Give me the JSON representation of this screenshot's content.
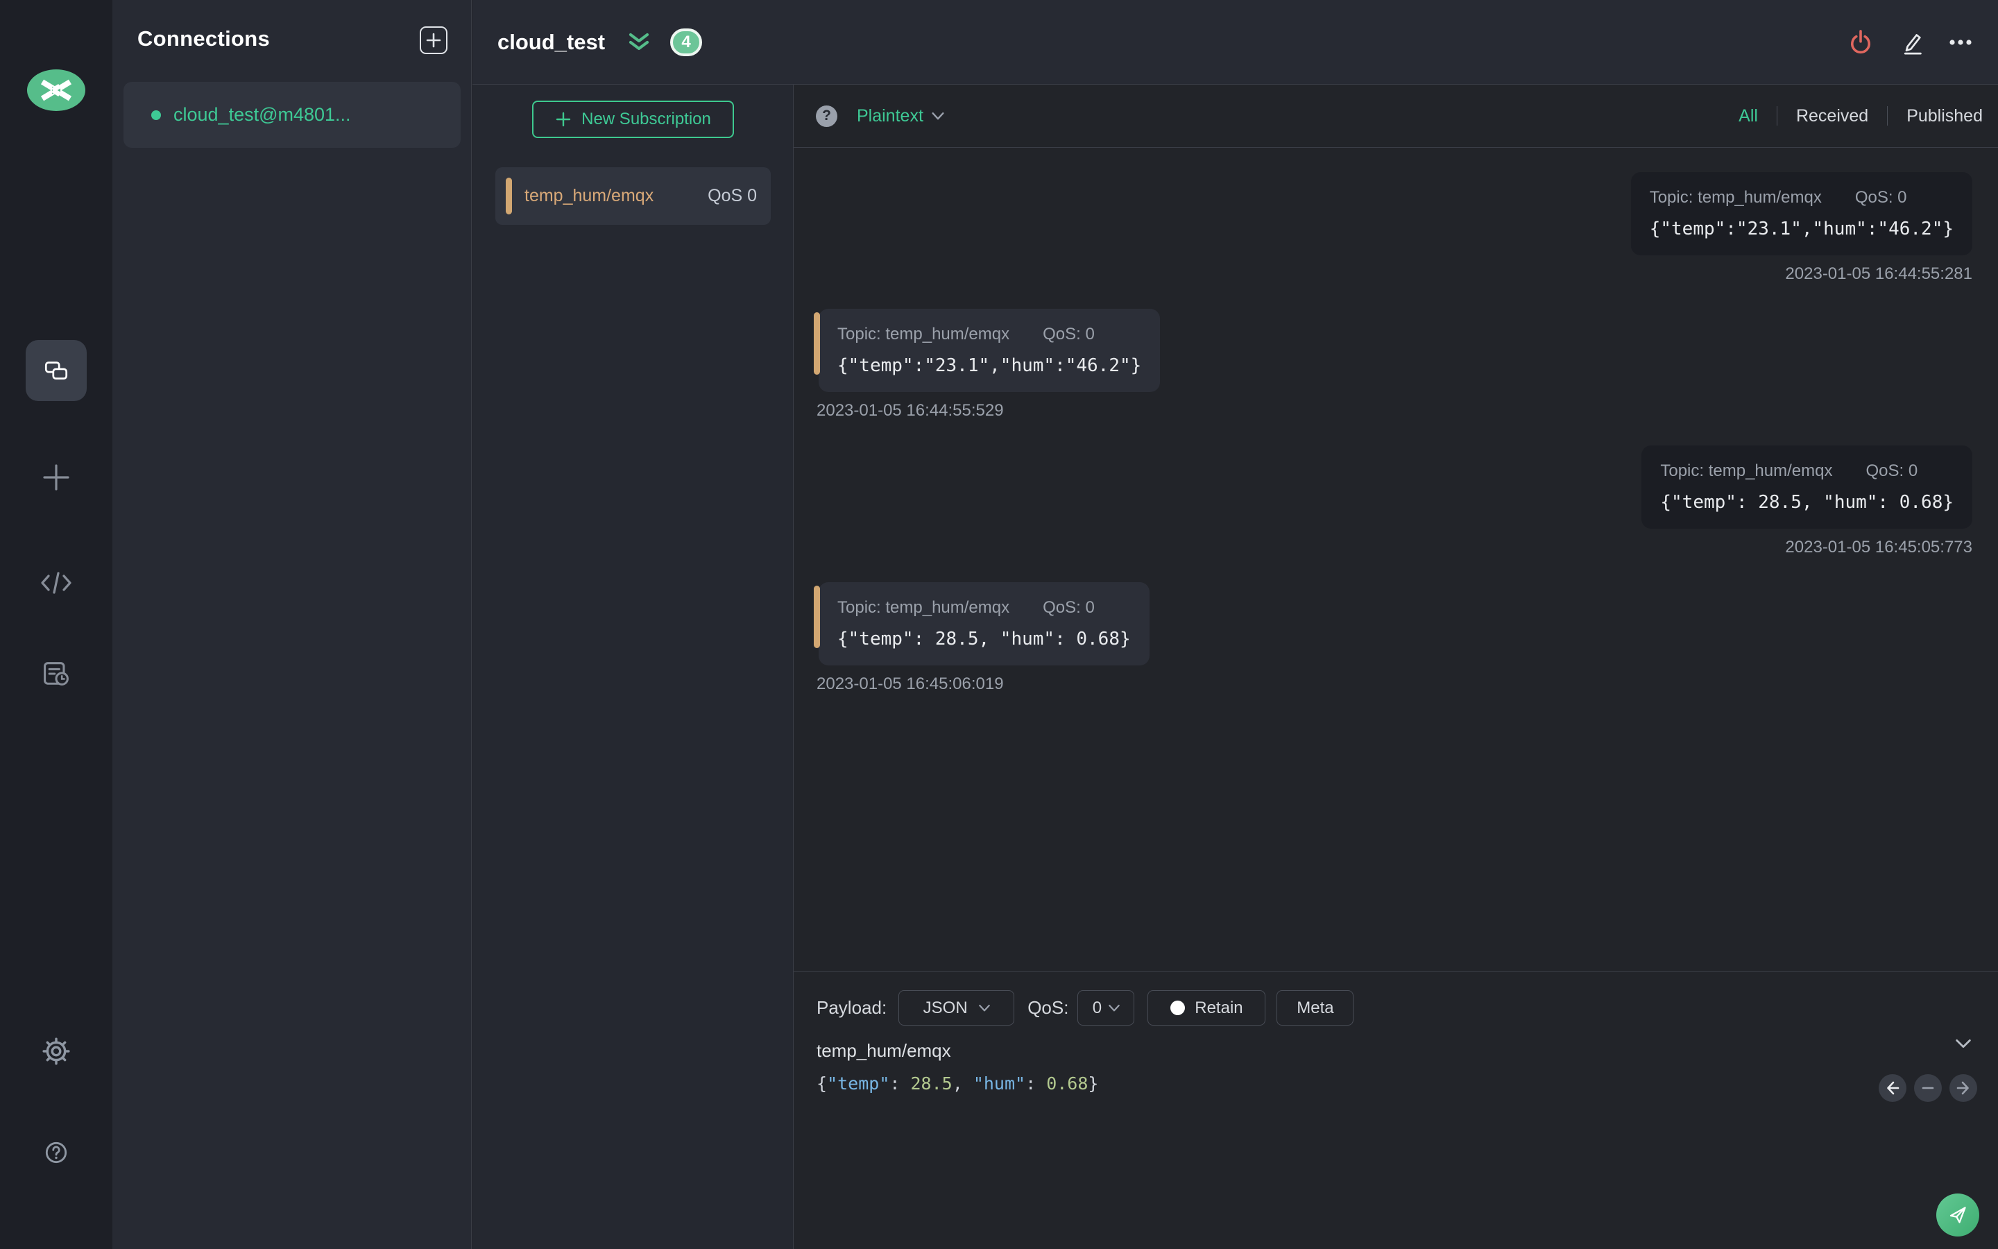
{
  "colors": {
    "accent_green": "#3ec995",
    "accent_tan": "#d2a772",
    "danger_red": "#e0675f"
  },
  "connections": {
    "title": "Connections",
    "items": [
      {
        "name": "cloud_test@m4801...",
        "online": true
      }
    ]
  },
  "header": {
    "title": "cloud_test",
    "unread_badge": "4"
  },
  "subscriptions": {
    "new_button": "New Subscription",
    "items": [
      {
        "topic": "temp_hum/emqx",
        "qos": "QoS 0"
      }
    ]
  },
  "filterbar": {
    "help": "?",
    "format": "Plaintext",
    "tabs": {
      "all": "All",
      "received": "Received",
      "published": "Published"
    },
    "active_tab": "All"
  },
  "messages": [
    {
      "type": "published",
      "topic": "Topic: temp_hum/emqx",
      "qos": "QoS: 0",
      "payload": "{\"temp\":\"23.1\",\"hum\":\"46.2\"}",
      "time": "2023-01-05 16:44:55:281"
    },
    {
      "type": "received",
      "topic": "Topic: temp_hum/emqx",
      "qos": "QoS: 0",
      "payload": "{\"temp\":\"23.1\",\"hum\":\"46.2\"}",
      "time": "2023-01-05 16:44:55:529"
    },
    {
      "type": "published",
      "topic": "Topic: temp_hum/emqx",
      "qos": "QoS: 0",
      "payload": "{\"temp\": 28.5, \"hum\": 0.68}",
      "time": "2023-01-05 16:45:05:773"
    },
    {
      "type": "received",
      "topic": "Topic: temp_hum/emqx",
      "qos": "QoS: 0",
      "payload": "{\"temp\": 28.5, \"hum\": 0.68}",
      "time": "2023-01-05 16:45:06:019"
    }
  ],
  "composer": {
    "payload_label": "Payload:",
    "format_value": "JSON",
    "qos_label": "QoS:",
    "qos_value": "0",
    "retain_label": "Retain",
    "meta_label": "Meta",
    "topic": "temp_hum/emqx",
    "payload_tokens": [
      {
        "text": "{",
        "kind": "punct"
      },
      {
        "text": "\"temp\"",
        "kind": "key"
      },
      {
        "text": ": ",
        "kind": "punct"
      },
      {
        "text": "28.5",
        "kind": "num"
      },
      {
        "text": ", ",
        "kind": "punct"
      },
      {
        "text": "\"hum\"",
        "kind": "key"
      },
      {
        "text": ": ",
        "kind": "punct"
      },
      {
        "text": "0.68",
        "kind": "num"
      },
      {
        "text": "}",
        "kind": "punct"
      }
    ]
  }
}
